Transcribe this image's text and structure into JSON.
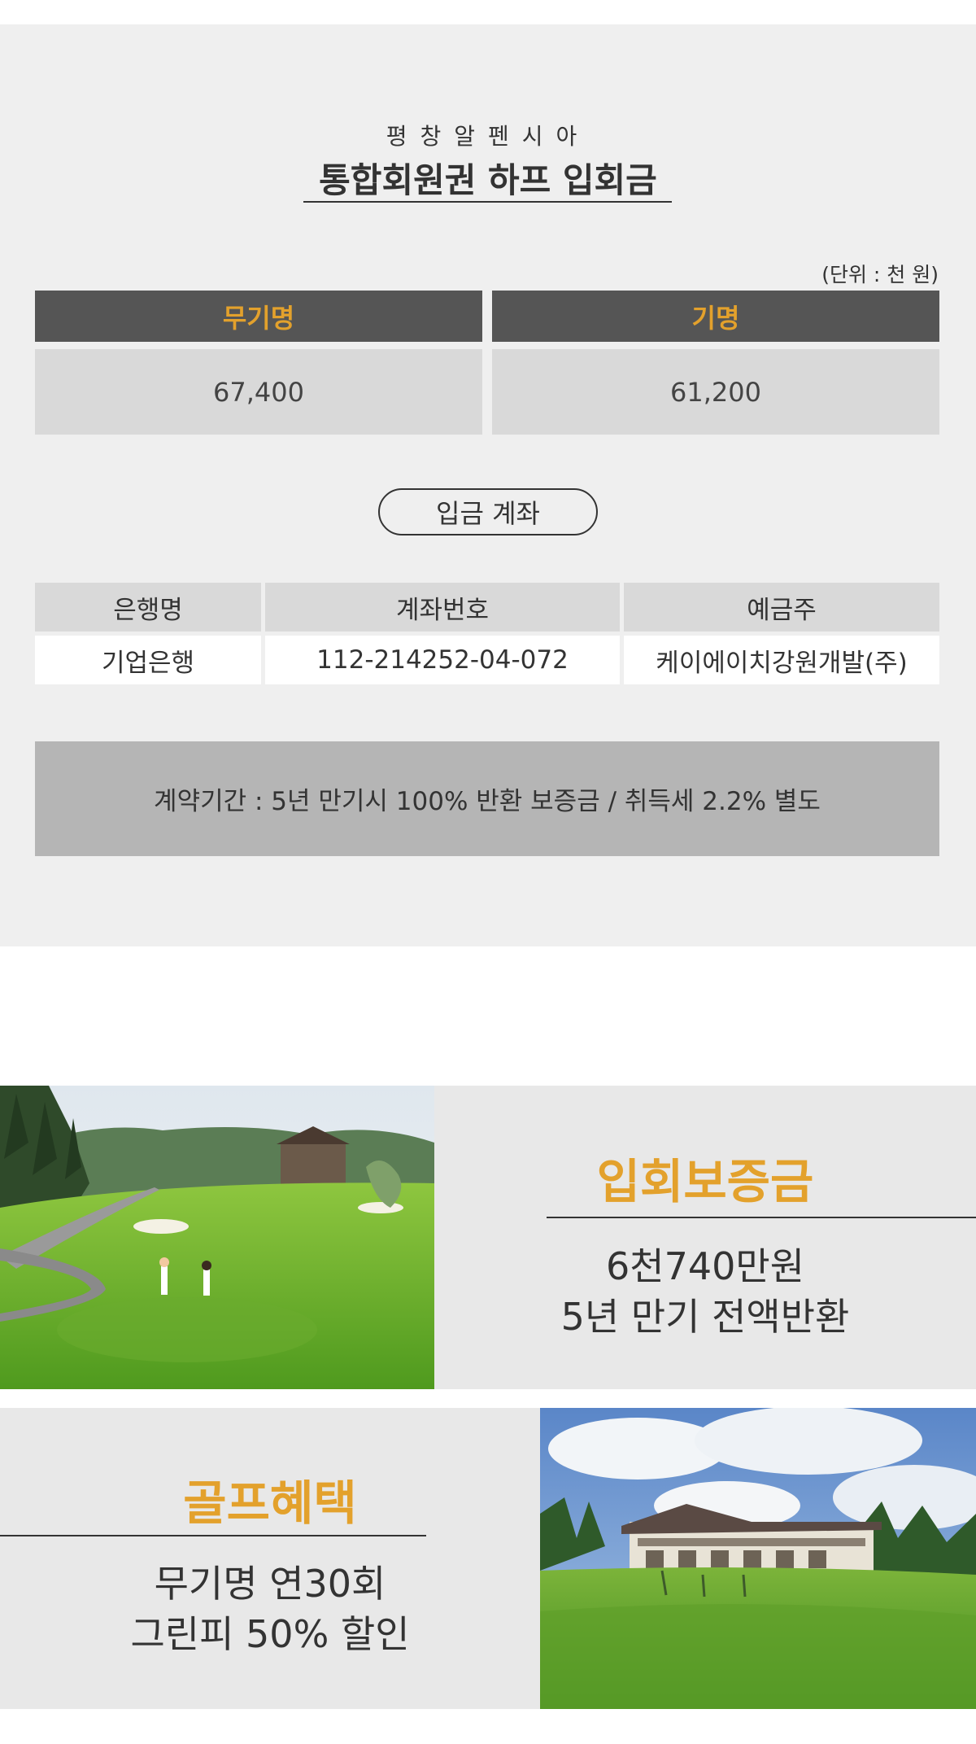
{
  "header": {
    "subtitle": "평창알펜시아",
    "title": "통합회원권 하프 입회금"
  },
  "price_table": {
    "unit": "(단위 : 천 원)",
    "columns": [
      {
        "label": "무기명",
        "value": "67,400"
      },
      {
        "label": "기명",
        "value": "61,200"
      }
    ]
  },
  "deposit_account": {
    "badge": "입금 계좌",
    "headers": [
      "은행명",
      "계좌번호",
      "예금주"
    ],
    "row": [
      "기업은행",
      "112-214252-04-072",
      "케이에이치강원개발(주)"
    ]
  },
  "notice": "계약기간 : 5년 만기시 100% 반환 보증금 / 취득세 2.2% 별도",
  "feature1": {
    "title": "입회보증금",
    "line1": "6천740만원",
    "line2": "5년 만기 전액반환"
  },
  "feature2": {
    "title": "골프혜택",
    "line1": "무기명 연30회",
    "line2": "그린피 50% 할인"
  },
  "colors": {
    "accent": "#e3a12c",
    "panel_bg": "#efefef",
    "header_bg": "#555555"
  }
}
